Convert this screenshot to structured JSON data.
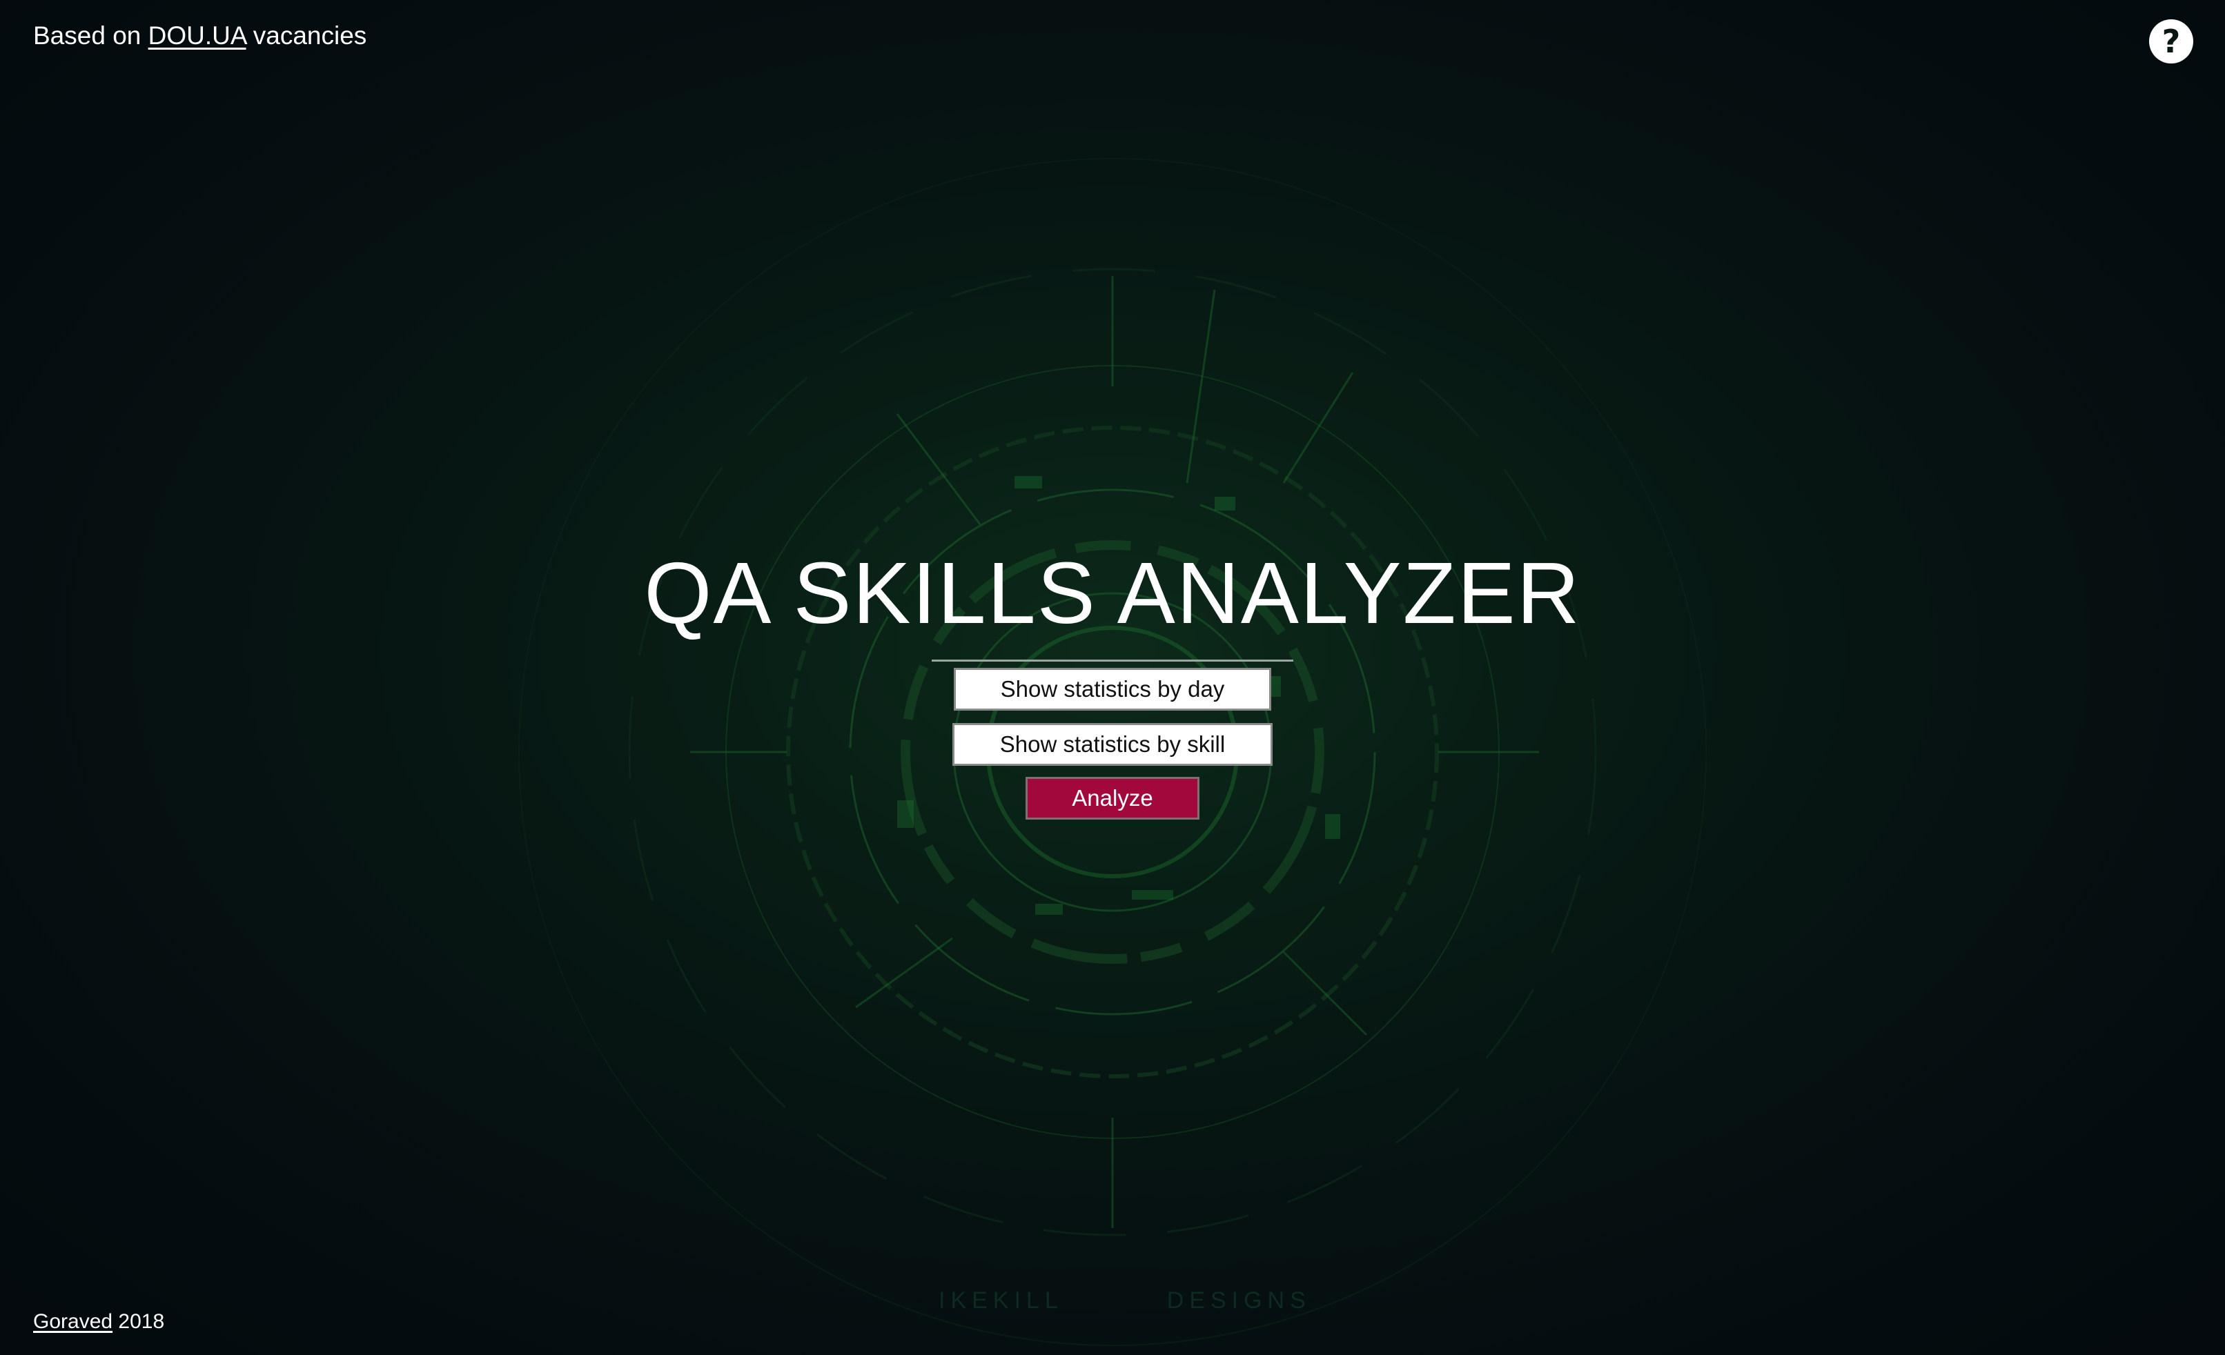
{
  "header": {
    "prefix": "Based on ",
    "link_label": "DOU.UA",
    "suffix": " vacancies"
  },
  "help_icon": {
    "glyph": "?",
    "icon": "help-circle-icon"
  },
  "main": {
    "title": "QA SKILLS ANALYZER",
    "buttons": {
      "by_day": "Show statistics by day",
      "by_skill": "Show statistics by skill",
      "analyze": "Analyze"
    }
  },
  "footer": {
    "author_link": "Goraved",
    "year": " 2018"
  },
  "background": {
    "watermark_left": "IKEKILL",
    "watermark_right": "DESIGNS"
  },
  "colors": {
    "background": "#06110f",
    "accent_green": "#1f7a2e",
    "analyze_button": "#a3083c",
    "text": "#ffffff"
  }
}
